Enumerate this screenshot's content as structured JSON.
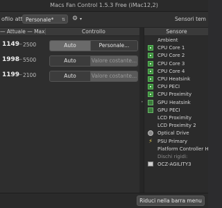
{
  "window": {
    "title": "Macs Fan Control 1.5.3 Free (iMac12,2)"
  },
  "toolbar": {
    "profile_label": "ofilo attivo:",
    "profile_value": "Personale*",
    "sensors_label": "Sensori tem"
  },
  "fans_header": {
    "rpm_label": "— Attuale — Max",
    "control_label": "Controllo"
  },
  "fans": [
    {
      "current": "1149",
      "max": "2500",
      "auto_label": "Auto",
      "custom_label": "Personale...",
      "mode": "auto"
    },
    {
      "current": "1998",
      "max": "5500",
      "auto_label": "Auto",
      "custom_label": "Valore costante...",
      "mode": "const"
    },
    {
      "current": "1199",
      "max": "2100",
      "auto_label": "Auto",
      "custom_label": "Valore costante...",
      "mode": "const"
    }
  ],
  "sensors_header": "Sensore",
  "sensors": [
    {
      "name": "Ambient",
      "icon": "none"
    },
    {
      "name": "CPU Core 1",
      "icon": "chip-icon"
    },
    {
      "name": "CPU Core 2",
      "icon": "chip-icon"
    },
    {
      "name": "CPU Core 3",
      "icon": "chip-icon"
    },
    {
      "name": "CPU Core 4",
      "icon": "chip-icon"
    },
    {
      "name": "CPU Heatsink",
      "icon": "chip-icon"
    },
    {
      "name": "CPU PECI",
      "icon": "chip-icon"
    },
    {
      "name": "CPU Proximity",
      "icon": "chip-icon"
    },
    {
      "name": "GPU Heatsink",
      "icon": "gpu-icon"
    },
    {
      "name": "GPU PECI",
      "icon": "gpu-icon"
    },
    {
      "name": "LCD Proximity",
      "icon": "none"
    },
    {
      "name": "LCD Proximity 2",
      "icon": "none"
    },
    {
      "name": "Optical Drive",
      "icon": "disc-icon"
    },
    {
      "name": "PSU Primary",
      "icon": "bolt-icon"
    },
    {
      "name": "Platform Controller Hub",
      "icon": "none"
    },
    {
      "name": "Dischi rigidi:",
      "icon": "none",
      "group": true
    },
    {
      "name": "OCZ-AGILITY3",
      "icon": "hdd-icon"
    }
  ],
  "bottom": {
    "minimize_label": "Riduci nella barra menu"
  }
}
